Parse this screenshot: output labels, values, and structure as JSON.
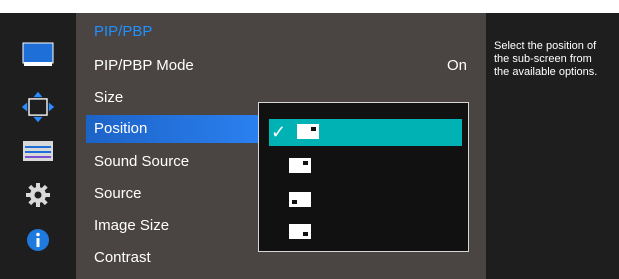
{
  "menu": {
    "header": "PIP/PBP",
    "items": [
      {
        "label": "PIP/PBP Mode",
        "value": "On"
      },
      {
        "label": "Size"
      },
      {
        "label": "Position"
      },
      {
        "label": "Sound Source"
      },
      {
        "label": "Source"
      },
      {
        "label": "Image Size"
      },
      {
        "label": "Contrast"
      }
    ],
    "selected_item": "Position"
  },
  "dropdown": {
    "options": [
      {
        "icon": "position-top-right-icon",
        "selected": true
      },
      {
        "icon": "position-top-right-icon",
        "selected": false
      },
      {
        "icon": "position-bottom-left-icon",
        "selected": false
      },
      {
        "icon": "position-bottom-right-icon",
        "selected": false
      }
    ],
    "check_glyph": "✓"
  },
  "help": {
    "text": "Select the position of\nthe sub-screen from\nthe available options."
  },
  "sidebar": {
    "icons": [
      "monitor-icon",
      "position-arrows-icon",
      "settings-sliders-icon",
      "gear-icon",
      "info-icon"
    ]
  },
  "colors": {
    "menu_header": "#1e90ff",
    "selected_item": "#2277e0",
    "selected_option": "#00b2b4",
    "rail_background": "#1e1e1e",
    "menu_background": "#4a4542"
  }
}
